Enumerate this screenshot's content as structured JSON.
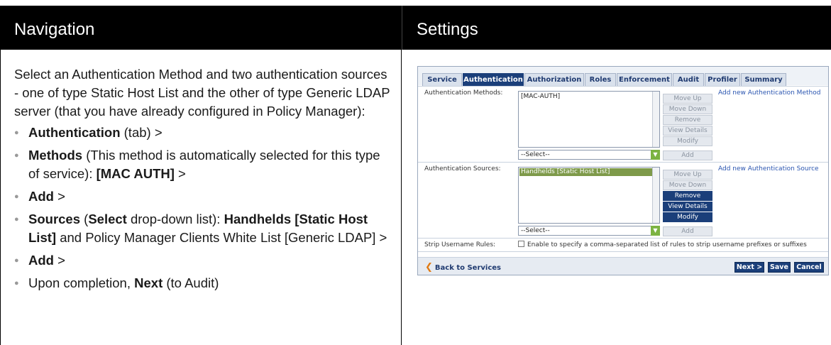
{
  "header": {
    "navigation": "Navigation",
    "settings": "Settings"
  },
  "navigation": {
    "intro": "Select an Authentication Method and two authentication sources - one of type Static Host List and the other of type Generic LDAP server (that you have already configured in Policy Manager):",
    "items": [
      {
        "bold": "Authentication",
        "rest": " (tab) >"
      },
      {
        "bold": "Methods",
        "rest": " (This method is automatically selected for this type of service): ",
        "bold2": "[MAC AUTH]",
        "rest2": " >"
      },
      {
        "bold": "Add",
        "rest": " >"
      },
      {
        "bold": "Sources",
        "rest": " (",
        "bold2": "Select",
        "rest2": " drop-down list): ",
        "bold3": "Handhelds [Static Host List]",
        "rest3": " and Policy Manager Clients White List [Generic LDAP] >"
      },
      {
        "bold": "Add",
        "rest": " >"
      },
      {
        "pre": "Upon completion, ",
        "bold": "Next",
        "rest": " (to Audit)"
      }
    ]
  },
  "screenshot": {
    "tabs": [
      "Service",
      "Authentication",
      "Authorization",
      "Roles",
      "Enforcement",
      "Audit",
      "Profiler",
      "Summary"
    ],
    "active_tab": "Authentication",
    "methods": {
      "label": "Authentication Methods:",
      "value": "[MAC-AUTH]",
      "select": "--Select--",
      "buttons": [
        "Move Up",
        "Move Down",
        "Remove",
        "View Details",
        "Modify"
      ],
      "add": "Add",
      "link": "Add new Authentication Method"
    },
    "sources": {
      "label": "Authentication Sources:",
      "value": "Handhelds [Static Host List]",
      "select": "--Select--",
      "buttons": [
        "Move Up",
        "Move Down",
        "Remove",
        "View Details",
        "Modify"
      ],
      "add": "Add",
      "link": "Add new Authentication Source"
    },
    "strip": {
      "label": "Strip Username Rules:",
      "text": "Enable to specify a comma-separated list of rules to strip username prefixes or suffixes"
    },
    "footer": {
      "back": "Back to Services",
      "next": "Next >",
      "save": "Save",
      "cancel": "Cancel"
    }
  }
}
